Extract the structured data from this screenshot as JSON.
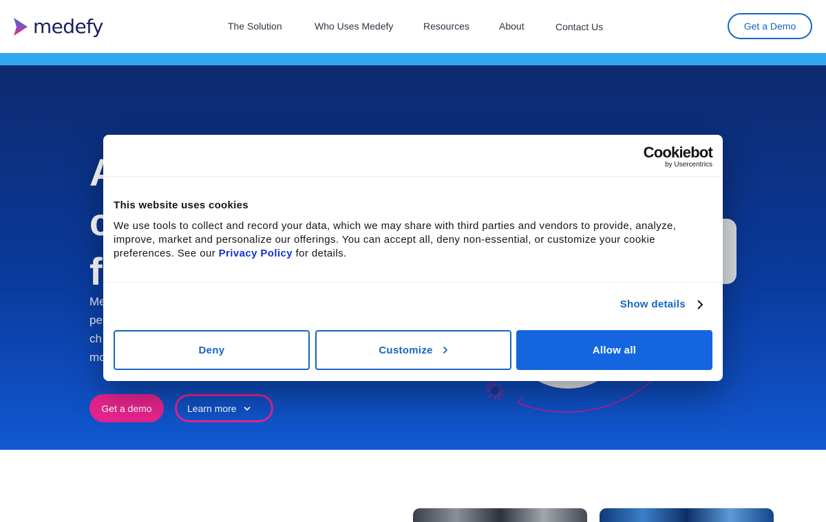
{
  "header": {
    "logo_text": "medefy",
    "nav": [
      {
        "label": "The Solution"
      },
      {
        "label": "Who Uses Medefy"
      },
      {
        "label": "Resources"
      },
      {
        "label": "About"
      },
      {
        "label": "Contact Us"
      }
    ],
    "demo_button": "Get a Demo"
  },
  "hero": {
    "headline_visible": "A\nc\nf",
    "body_visible": "Me\npe\nch\nmo",
    "demo_button": "Get a demo",
    "learn_button": "Learn more"
  },
  "cookie_dialog": {
    "brand": "Cookiebot",
    "brand_sub": "by Usercentrics",
    "title": "This website uses cookies",
    "text_before_link": "We use tools to collect and record your data, which we may share with third parties and vendors to provide, analyze, improve, market and personalize our offerings. You can accept all, deny non-essential, or customize your cookie preferences. See our ",
    "link_text": "Privacy Policy",
    "text_after_link": " for details.",
    "show_details": "Show details",
    "deny": "Deny",
    "customize": "Customize",
    "allow_all": "Allow all"
  },
  "colors": {
    "brand_navy": "#1b1f5e",
    "brand_pink": "#e6248e",
    "accent_blue": "#1565c0",
    "strip_blue": "#30a8f0",
    "allow_blue": "#1565e0"
  },
  "icons": [
    "medefy-chevron-logo-icon",
    "chevron-down-icon",
    "chevron-right-icon"
  ]
}
